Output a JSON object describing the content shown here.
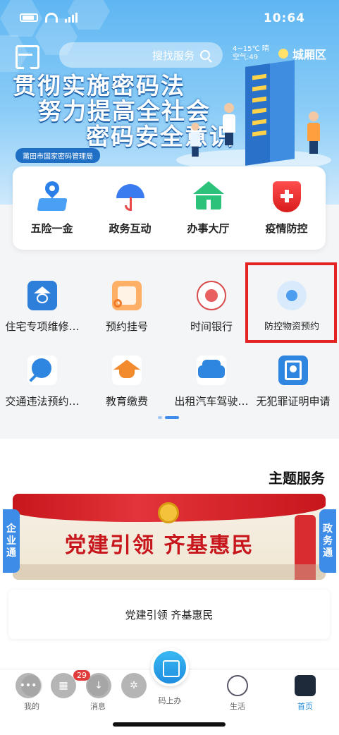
{
  "status_bar": {
    "time": "10:64"
  },
  "header": {
    "search_placeholder": "搜找服务",
    "city": "城厢区",
    "weather_line1": "4~15℃ 晴",
    "weather_line2": "空气:49",
    "slogan_lines": [
      "贯彻实施密码法",
      "努力提高全社会",
      "密码安全意识"
    ],
    "org_label": "莆田市国家密码管理局",
    "colors": {
      "sky": "#5fb6f2",
      "brand_blue": "#1f6fc4"
    }
  },
  "quick_services": [
    {
      "label": "疫情防控",
      "icon": "shield-cross-icon"
    },
    {
      "label": "办事大厅",
      "icon": "building-icon"
    },
    {
      "label": "政务互动",
      "icon": "umbrella-icon"
    },
    {
      "label": "五险一金",
      "icon": "map-pin-icon"
    }
  ],
  "services_row1": [
    {
      "label": "防控物资预约",
      "icon": "mask-icon"
    },
    {
      "label": "时间银行",
      "icon": "bank-seal-icon"
    },
    {
      "label": "预约挂号",
      "icon": "hospital-icon"
    },
    {
      "label": "住宅专项维修…",
      "icon": "house-coin-icon"
    }
  ],
  "services_row2": [
    {
      "label": "无犯罪证明申请",
      "icon": "id-card-icon"
    },
    {
      "label": "出租汽车驾驶…",
      "icon": "car-icon"
    },
    {
      "label": "教育缴费",
      "icon": "graduation-cap-icon"
    },
    {
      "label": "交通违法预约…",
      "icon": "traffic-search-icon"
    }
  ],
  "theme": {
    "title": "主题服务",
    "banner_text": "党建引领 齐基惠民",
    "caption": "党建引领 齐基惠民",
    "side_left": [
      "企",
      "业",
      "通"
    ],
    "side_right": [
      "政",
      "务",
      "通"
    ]
  },
  "bottom_nav": {
    "items": [
      {
        "label": "首页",
        "icon": "home-icon"
      },
      {
        "label": "生活",
        "icon": "planet-icon"
      },
      {
        "label": "码上办",
        "icon": "scan-code-icon"
      },
      {
        "label": "消息",
        "icon": "message-icon"
      },
      {
        "label": "我的",
        "icon": "user-icon"
      }
    ],
    "badge": "29"
  }
}
